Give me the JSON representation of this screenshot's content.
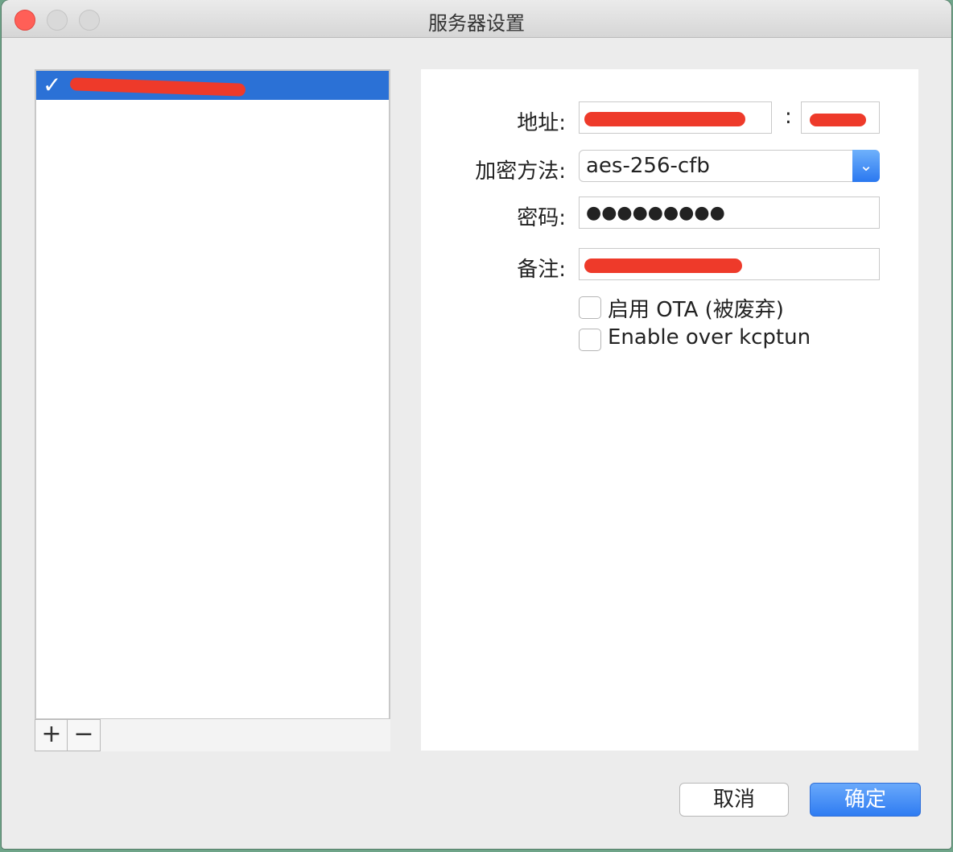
{
  "window": {
    "title": "服务器设置"
  },
  "server_list": {
    "items": [
      {
        "check": "✓",
        "selected": true
      }
    ],
    "add_label": "+",
    "remove_label": "−"
  },
  "form": {
    "address_label": "地址:",
    "port_separator": ":",
    "encryption_label": "加密方法:",
    "encryption_value": "aes-256-cfb",
    "password_label": "密码:",
    "password_value": "●●●●●●●●●",
    "remark_label": "备注:",
    "ota_label": "启用 OTA (被废弃)",
    "kcptun_label": "Enable over kcptun"
  },
  "buttons": {
    "cancel": "取消",
    "ok": "确定"
  },
  "colors": {
    "selection": "#2b71d6",
    "accent": "#2f7cf2",
    "close": "#ff5f57",
    "redaction": "#ee3a2a"
  }
}
